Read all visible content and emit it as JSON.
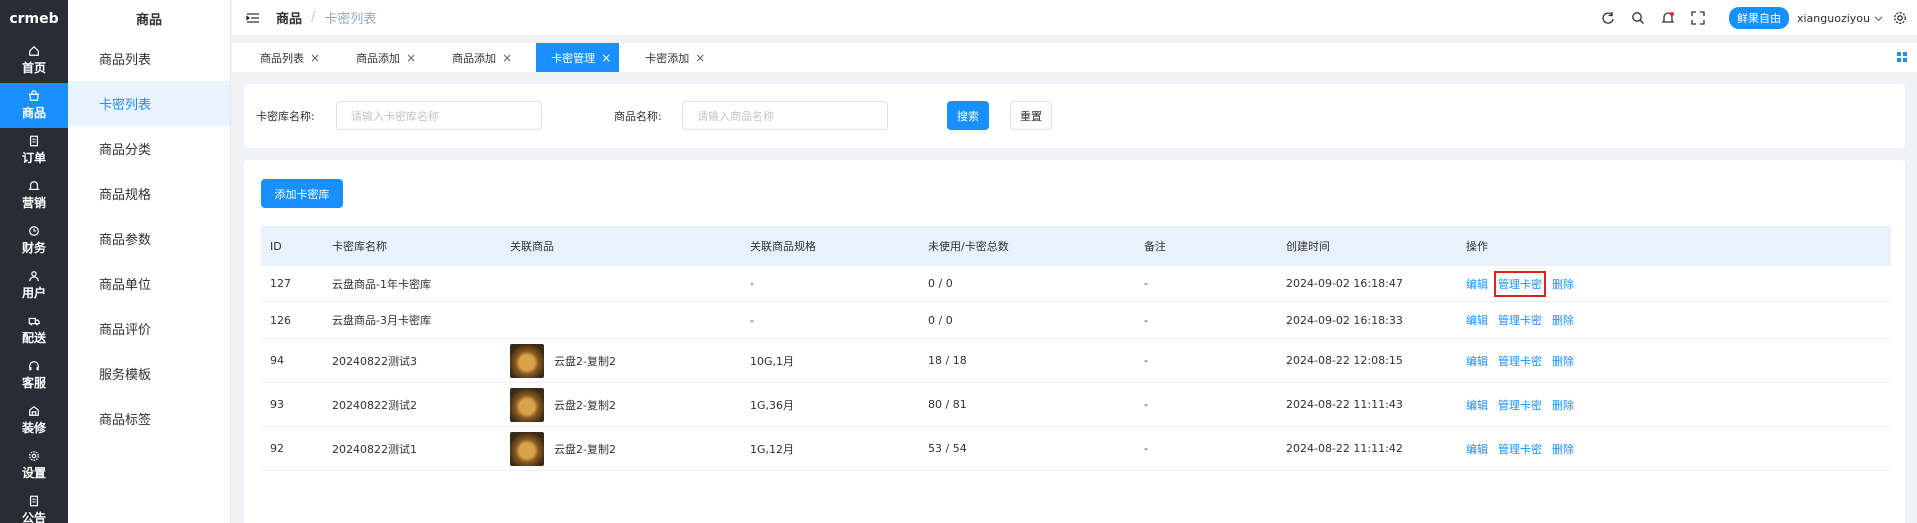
{
  "logo": "crmeb",
  "rail": [
    {
      "label": "首页",
      "icon": "home-icon",
      "active": false
    },
    {
      "label": "商品",
      "icon": "bag-icon",
      "active": true
    },
    {
      "label": "订单",
      "icon": "document-icon",
      "active": false
    },
    {
      "label": "营销",
      "icon": "bell-icon",
      "active": false
    },
    {
      "label": "财务",
      "icon": "clock-icon",
      "active": false
    },
    {
      "label": "用户",
      "icon": "user-icon",
      "active": false
    },
    {
      "label": "配送",
      "icon": "truck-icon",
      "active": false
    },
    {
      "label": "客服",
      "icon": "headset-icon",
      "active": false
    },
    {
      "label": "装修",
      "icon": "brush-icon",
      "active": false
    },
    {
      "label": "设置",
      "icon": "gear-icon",
      "active": false
    },
    {
      "label": "公告",
      "icon": "notice-icon",
      "active": false
    }
  ],
  "submenu": {
    "title": "商品",
    "items": [
      "商品列表",
      "卡密列表",
      "商品分类",
      "商品规格",
      "商品参数",
      "商品单位",
      "商品评价",
      "服务模板",
      "商品标签"
    ],
    "active_index": 1
  },
  "header": {
    "crumb1": "商品",
    "separator": "/",
    "crumb2": "卡密列表",
    "badge": "鲜果自由",
    "username": "xianguoziyou"
  },
  "tabs": [
    {
      "label": "商品列表",
      "active": false
    },
    {
      "label": "商品添加",
      "active": false
    },
    {
      "label": "商品添加",
      "active": false
    },
    {
      "label": "卡密管理",
      "active": true
    },
    {
      "label": "卡密添加",
      "active": false
    }
  ],
  "search": {
    "label1": "卡密库名称:",
    "placeholder1": "请输入卡密库名称",
    "label2": "商品名称:",
    "placeholder2": "请输入商品名称",
    "search_btn": "搜索",
    "reset_btn": "重置"
  },
  "add_button": "添加卡密库",
  "table": {
    "columns": [
      "ID",
      "卡密库名称",
      "关联商品",
      "关联商品规格",
      "未使用/卡密总数",
      "备注",
      "创建时间",
      "操作"
    ],
    "rows": [
      {
        "id": "127",
        "name": "云盘商品-1年卡密库",
        "product": "",
        "spec": "-",
        "count": "0 / 0",
        "note": "-",
        "time": "2024-09-02 16:18:47"
      },
      {
        "id": "126",
        "name": "云盘商品-3月卡密库",
        "product": "",
        "spec": "-",
        "count": "0 / 0",
        "note": "-",
        "time": "2024-09-02 16:18:33"
      },
      {
        "id": "94",
        "name": "20240822测试3",
        "product": "云盘2-复制2",
        "spec": "10G,1月",
        "count": "18 / 18",
        "note": "-",
        "time": "2024-08-22 12:08:15"
      },
      {
        "id": "93",
        "name": "20240822测试2",
        "product": "云盘2-复制2",
        "spec": "1G,36月",
        "count": "80 / 81",
        "note": "-",
        "time": "2024-08-22 11:11:43"
      },
      {
        "id": "92",
        "name": "20240822测试1",
        "product": "云盘2-复制2",
        "spec": "1G,12月",
        "count": "53 / 54",
        "note": "-",
        "time": "2024-08-22 11:11:42"
      }
    ],
    "actions": {
      "edit": "编辑",
      "manage": "管理卡密",
      "delete": "删除"
    }
  }
}
